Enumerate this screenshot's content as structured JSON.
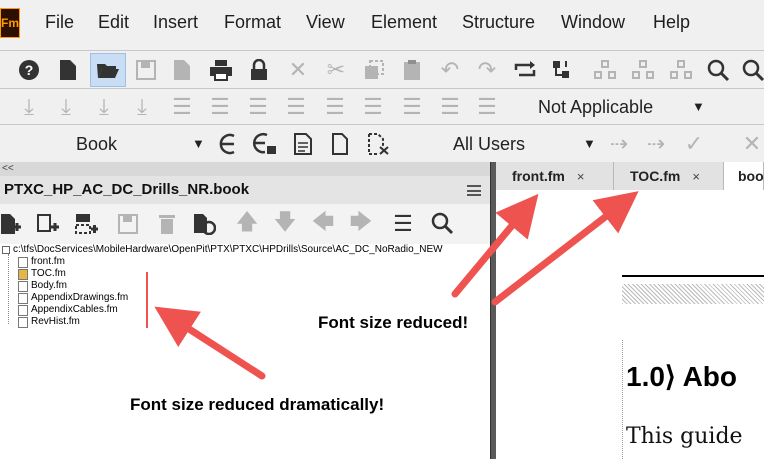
{
  "app": {
    "logo_text": "Fm"
  },
  "menu": {
    "items": [
      "File",
      "Edit",
      "Insert",
      "Format",
      "View",
      "Element",
      "Structure",
      "Window",
      "Help"
    ]
  },
  "toolbar2": {
    "para_style_value": "Not Applicable"
  },
  "toolbar3": {
    "catalog_value": "Book",
    "user_view_value": "All Users"
  },
  "book_panel": {
    "collapse_glyph": "<<",
    "title": "PTXC_HP_AC_DC_Drills_NR.book",
    "root_path": "c:\\tfs\\DocServices\\MobileHardware\\OpenPit\\PTX\\PTXC\\HPDrills\\Source\\AC_DC_NoRadio_NEW",
    "files": [
      "front.fm",
      "TOC.fm",
      "Body.fm",
      "AppendixDrawings.fm",
      "AppendixCables.fm",
      "RevHist.fm"
    ]
  },
  "doc": {
    "tabs": [
      {
        "label": "front.fm",
        "close": "×"
      },
      {
        "label": "TOC.fm",
        "close": "×"
      },
      {
        "label": "boo"
      }
    ],
    "heading": "1.0⟩ Abo",
    "body": "This guide"
  },
  "annotations": {
    "left": "Font size reduced dramatically!",
    "right": "Font size reduced!",
    "arrow_color": "#ef5350"
  }
}
